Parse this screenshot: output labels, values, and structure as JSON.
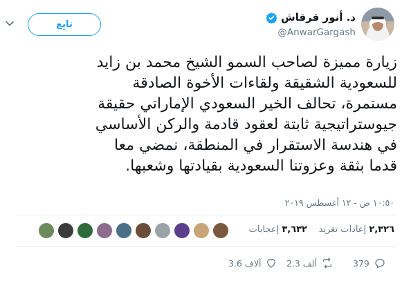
{
  "author": {
    "display_name": "د. أنور قرقاش",
    "handle": "@AnwarGargash",
    "verified_color": "#1da1f2"
  },
  "follow_label": "تابِع",
  "tweet": {
    "lines": [
      "زيارة مميزة لصاحب السمو الشيخ محمد بن زايد",
      "للسعودية الشقيقة ولقاءات الأخوة الصادقة",
      "مستمرة، تحالف الخير السعودي الإماراتي حقيقة",
      "جيوستراتيجية ثابتة لعقود قادمة والركن الأساسي",
      "في هندسة الاستقرار في المنطقة، نمضي معا",
      "قدما بثقة وعزوتنا السعودية بقيادتها وشعبها."
    ],
    "timestamp": "١٠:٥٠ ص - ١٢ أغسطس ٢٠١٩"
  },
  "stats": {
    "retweets_count": "٢,٣٢٦",
    "retweets_label": "إعادات تغريد",
    "likes_count": "٣,٦٣٢",
    "likes_label": "إعجابات"
  },
  "actions": {
    "replies": "379",
    "retweets": "2.3 ألف",
    "likes": "3.6 آلاف"
  },
  "colors": {
    "accent": "#1da1f2",
    "muted": "#657786",
    "text": "#14171a",
    "divider": "#e6ecf0"
  }
}
